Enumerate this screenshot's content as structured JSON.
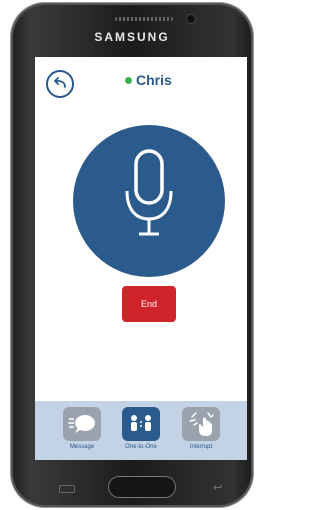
{
  "device": {
    "brand": "SAMSUNG"
  },
  "call": {
    "contact_name": "Chris",
    "status_color": "#37b24d",
    "end_label": "End"
  },
  "icons": {
    "back": "back-arrow-icon",
    "microphone": "microphone-icon",
    "message": "speech-bubble-icon",
    "one_to_one": "two-people-icon",
    "interrupt": "hand-tap-icon"
  },
  "tabs": [
    {
      "label": "Message",
      "active": false
    },
    {
      "label": "One-to-One",
      "active": true
    },
    {
      "label": "Interrupt",
      "active": false
    }
  ],
  "colors": {
    "primary": "#2b5a8c",
    "danger": "#d0232a",
    "tabbar_bg": "#c3d2e4"
  }
}
